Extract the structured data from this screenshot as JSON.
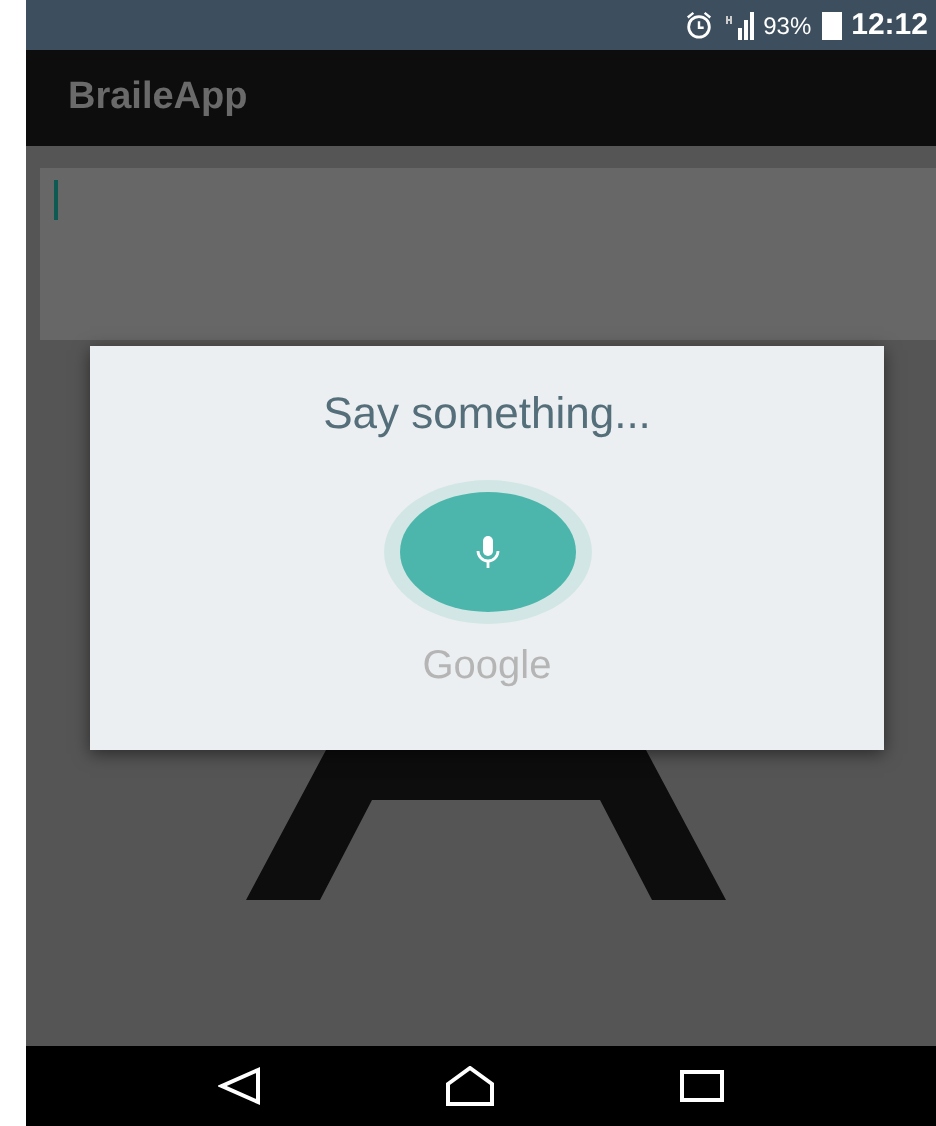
{
  "status_bar": {
    "battery": "93%",
    "time": "12:12"
  },
  "app_bar": {
    "title": "BraileApp"
  },
  "text_field": {
    "focused": true
  },
  "voice_dialog": {
    "prompt": "Say something...",
    "listening": true,
    "brand": "Google"
  }
}
